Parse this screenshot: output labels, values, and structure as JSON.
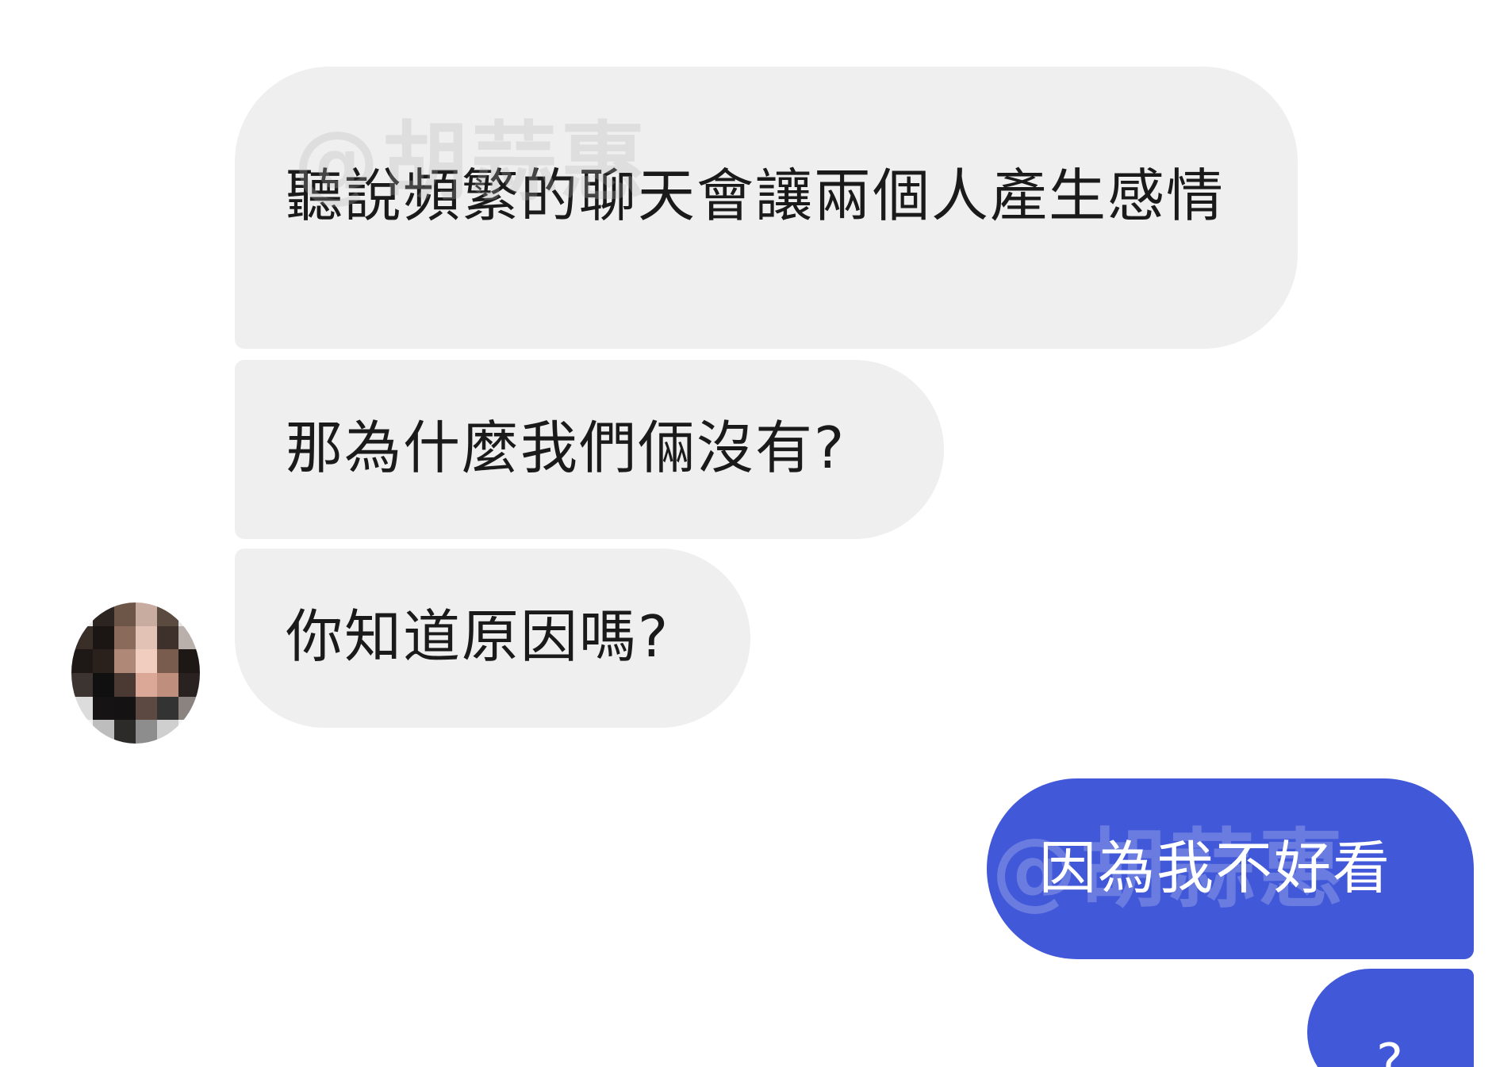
{
  "messages": [
    {
      "sender": "them",
      "text": "聽說頻繁的聊天會讓兩個人產生感情"
    },
    {
      "sender": "them",
      "text": "那為什麼我們倆沒有?"
    },
    {
      "sender": "them",
      "text": "你知道原因嗎?"
    },
    {
      "sender": "me",
      "text": "因為我不好看"
    },
    {
      "sender": "me",
      "text": "?"
    }
  ],
  "watermark": "@胡蒜惠",
  "colors": {
    "incoming_bubble": "#efefef",
    "outgoing_bubble": "#4158d8",
    "background": "#ffffff"
  },
  "avatar": {
    "icon": "pixelated-avatar"
  }
}
